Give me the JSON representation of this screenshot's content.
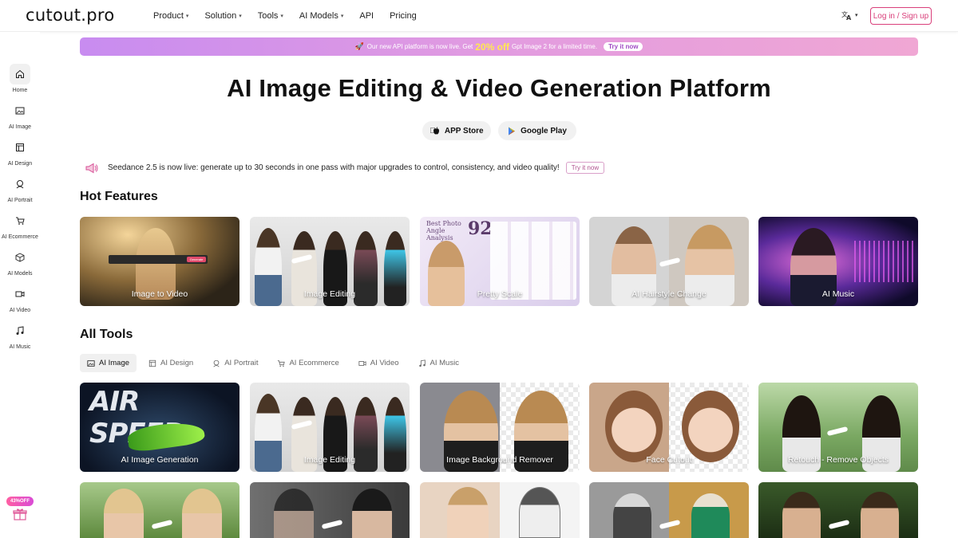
{
  "brand": {
    "logo_text": "cutout.pro"
  },
  "nav": {
    "items": [
      {
        "label": "Product",
        "dropdown": true
      },
      {
        "label": "Solution",
        "dropdown": true
      },
      {
        "label": "Tools",
        "dropdown": true
      },
      {
        "label": "AI Models",
        "dropdown": true
      },
      {
        "label": "API",
        "dropdown": false
      },
      {
        "label": "Pricing",
        "dropdown": false
      }
    ],
    "language_icon": "translate-icon",
    "login_label": "Log in / Sign up"
  },
  "sidebar": {
    "items": [
      {
        "label": "Home",
        "icon": "home-icon",
        "active": true
      },
      {
        "label": "AI Image",
        "icon": "image-icon"
      },
      {
        "label": "AI Design",
        "icon": "layout-icon"
      },
      {
        "label": "AI Portrait",
        "icon": "portrait-icon"
      },
      {
        "label": "AI Ecommerce",
        "icon": "cart-icon"
      },
      {
        "label": "AI Models",
        "icon": "cube-icon"
      },
      {
        "label": "AI Video",
        "icon": "video-icon"
      },
      {
        "label": "AI Music",
        "icon": "music-icon"
      }
    ],
    "promo_badge": "43%OFF",
    "promo_icon": "gift-icon"
  },
  "banner": {
    "text_before": "Our new API platform is now live. Get",
    "highlight": "20% off",
    "text_after": "Gpt Image 2 for a limited time.",
    "cta": "Try it now"
  },
  "hero": {
    "title": "AI Image Editing & Video Generation Platform",
    "app_store": "APP Store",
    "google_play": "Google Play"
  },
  "notice": {
    "text": "Seedance 2.5 is now live: generate up to 30 seconds in one pass with major upgrades to control, consistency, and video quality!",
    "cta": "Try it now"
  },
  "hot_features": {
    "title": "Hot Features",
    "cards": [
      {
        "label": "Image to Video",
        "image_text": "Generate"
      },
      {
        "label": "Image Editing"
      },
      {
        "label": "Pretty Scale",
        "image_text": "Best Photo Angle Analysis",
        "score": "92"
      },
      {
        "label": "AI Hairstyle Change"
      },
      {
        "label": "AI Music"
      }
    ]
  },
  "all_tools": {
    "title": "All Tools",
    "tabs": [
      {
        "label": "AI Image",
        "icon": "image-icon",
        "active": true
      },
      {
        "label": "AI Design",
        "icon": "layout-icon"
      },
      {
        "label": "AI Portrait",
        "icon": "portrait-icon"
      },
      {
        "label": "AI Ecommerce",
        "icon": "cart-icon"
      },
      {
        "label": "AI Video",
        "icon": "video-icon"
      },
      {
        "label": "AI Music",
        "icon": "music-icon"
      }
    ],
    "cards": [
      {
        "label": "AI Image Generation",
        "image_text": "AIR SPEED"
      },
      {
        "label": "Image Editing"
      },
      {
        "label": "Image Background Remover"
      },
      {
        "label": "Face Cutout"
      },
      {
        "label": "Retouch - Remove Objects"
      }
    ]
  },
  "colors": {
    "accent": "#d93f7a",
    "banner_start": "#c88cf0",
    "banner_end": "#f0a7d4"
  }
}
